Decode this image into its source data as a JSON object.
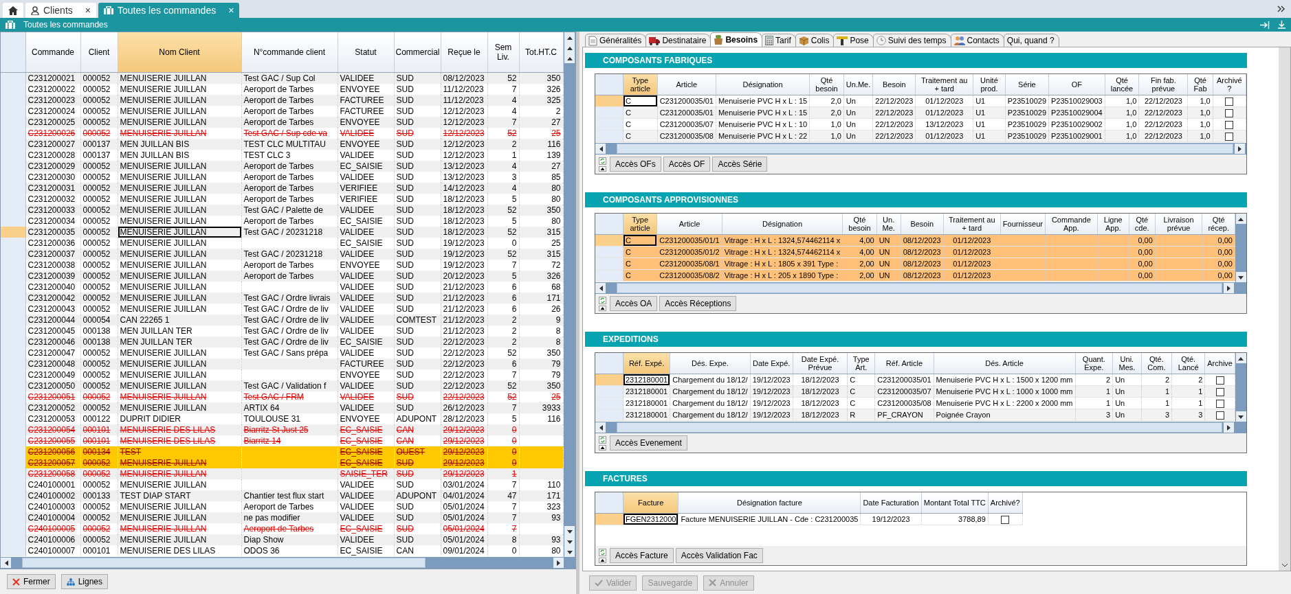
{
  "app_tabs": [
    {
      "label": "Clients",
      "selected": false,
      "close": "×"
    },
    {
      "label": "Toutes les commandes",
      "selected": true,
      "close": "×"
    }
  ],
  "orders": {
    "title": "Toutes les commandes",
    "columns": [
      {
        "label": "Commande",
        "sorted": false
      },
      {
        "label": "Client",
        "sorted": false
      },
      {
        "label": "Nom Client",
        "sorted": true
      },
      {
        "label": "N°commande client",
        "sorted": false
      },
      {
        "label": "Statut",
        "sorted": false
      },
      {
        "label": "Commercial",
        "sorted": false
      },
      {
        "label": "Reçue le",
        "sorted": false
      },
      {
        "label": "Sem Liv.",
        "sorted": false
      },
      {
        "label": "Tot.HT.C",
        "sorted": false
      }
    ],
    "rows": [
      {
        "selected": false,
        "deleted": false,
        "highlighted": false,
        "cells": [
          "C231200021",
          "000052",
          "MENUISERIE JUILLAN",
          "Test GAC / Sup Col",
          "VALIDEE",
          "SUD",
          "08/12/2023",
          "52",
          "350"
        ]
      },
      {
        "selected": false,
        "deleted": false,
        "highlighted": false,
        "cells": [
          "C231200022",
          "000052",
          "MENUISERIE JUILLAN",
          "Aeroport de Tarbes",
          "ENVOYEE",
          "SUD",
          "11/12/2023",
          "7",
          "326"
        ]
      },
      {
        "selected": false,
        "deleted": false,
        "highlighted": false,
        "cells": [
          "C231200023",
          "000052",
          "MENUISERIE JUILLAN",
          "Aeroport de Tarbes",
          "FACTUREE",
          "SUD",
          "11/12/2023",
          "4",
          "325"
        ]
      },
      {
        "selected": false,
        "deleted": false,
        "highlighted": false,
        "cells": [
          "C231200024",
          "000052",
          "MENUISERIE JUILLAN",
          "Aeroport de Tarbes",
          "FACTUREE",
          "SUD",
          "12/12/2023",
          "4",
          "2"
        ]
      },
      {
        "selected": false,
        "deleted": false,
        "highlighted": false,
        "cells": [
          "C231200025",
          "000052",
          "MENUISERIE JUILLAN",
          "Aeroport de Tarbes",
          "ENVOYEE",
          "SUD",
          "12/12/2023",
          "7",
          "27"
        ]
      },
      {
        "selected": false,
        "deleted": true,
        "highlighted": false,
        "cells": [
          "C231200026",
          "000052",
          "MENUISERIE JUILLAN",
          "Test GAC / Sup cde va",
          "VALIDEE",
          "SUD",
          "12/12/2023",
          "52",
          "25"
        ]
      },
      {
        "selected": false,
        "deleted": false,
        "highlighted": false,
        "cells": [
          "C231200027",
          "000137",
          "MEN JUILLAN BIS",
          "TEST CLC MULTITAU",
          "ENVOYEE",
          "SUD",
          "12/12/2023",
          "2",
          "116"
        ]
      },
      {
        "selected": false,
        "deleted": false,
        "highlighted": false,
        "cells": [
          "C231200028",
          "000137",
          "MEN JUILLAN BIS",
          "TEST CLC 3",
          "VALIDEE",
          "SUD",
          "12/12/2023",
          "1",
          "139"
        ]
      },
      {
        "selected": false,
        "deleted": false,
        "highlighted": false,
        "cells": [
          "C231200029",
          "000052",
          "MENUISERIE JUILLAN",
          "Aeroport de Tarbes",
          "EC_SAISIE",
          "SUD",
          "13/12/2023",
          "4",
          "27"
        ]
      },
      {
        "selected": false,
        "deleted": false,
        "highlighted": false,
        "cells": [
          "C231200030",
          "000052",
          "MENUISERIE JUILLAN",
          "Aeroport de Tarbes",
          "VALIDEE",
          "SUD",
          "13/12/2023",
          "3",
          "85"
        ]
      },
      {
        "selected": false,
        "deleted": false,
        "highlighted": false,
        "cells": [
          "C231200031",
          "000052",
          "MENUISERIE JUILLAN",
          "Aeroport de Tarbes",
          "VERIFIEE",
          "SUD",
          "14/12/2023",
          "4",
          "80"
        ]
      },
      {
        "selected": false,
        "deleted": false,
        "highlighted": false,
        "cells": [
          "C231200032",
          "000052",
          "MENUISERIE JUILLAN",
          "Aeroport de Tarbes",
          "VERIFIEE",
          "SUD",
          "18/12/2023",
          "5",
          "80"
        ]
      },
      {
        "selected": false,
        "deleted": false,
        "highlighted": false,
        "cells": [
          "C231200033",
          "000052",
          "MENUISERIE JUILLAN",
          "Test GAC / Palette de",
          "VALIDEE",
          "SUD",
          "18/12/2023",
          "52",
          "350"
        ]
      },
      {
        "selected": false,
        "deleted": false,
        "highlighted": false,
        "cells": [
          "C231200034",
          "000052",
          "MENUISERIE JUILLAN",
          "Aeroport de Tarbes",
          "EC_SAISIE",
          "SUD",
          "18/12/2023",
          "5",
          "80"
        ]
      },
      {
        "selected": true,
        "deleted": false,
        "highlighted": false,
        "cells": [
          "C231200035",
          "000052",
          "MENUISERIE JUILLAN",
          "Test GAC / 20231218",
          "VALIDEE",
          "SUD",
          "18/12/2023",
          "52",
          "315"
        ]
      },
      {
        "selected": false,
        "deleted": false,
        "highlighted": false,
        "cells": [
          "C231200036",
          "000052",
          "MENUISERIE JUILLAN",
          null,
          "EC_SAISIE",
          "SUD",
          "19/12/2023",
          "0",
          "25"
        ]
      },
      {
        "selected": false,
        "deleted": false,
        "highlighted": false,
        "cells": [
          "C231200037",
          "000052",
          "MENUISERIE JUILLAN",
          "Test GAC / 20231218",
          "VALIDEE",
          "SUD",
          "19/12/2023",
          "52",
          "315"
        ]
      },
      {
        "selected": false,
        "deleted": false,
        "highlighted": false,
        "cells": [
          "C231200038",
          "000052",
          "MENUISERIE JUILLAN",
          "Aeroport de Tarbes",
          "ENVOYEE",
          "SUD",
          "19/12/2023",
          "7",
          "72"
        ]
      },
      {
        "selected": false,
        "deleted": false,
        "highlighted": false,
        "cells": [
          "C231200039",
          "000052",
          "MENUISERIE JUILLAN",
          "Aeroport de Tarbes",
          "VALIDEE",
          "SUD",
          "20/12/2023",
          "5",
          "326"
        ]
      },
      {
        "selected": false,
        "deleted": false,
        "highlighted": false,
        "cells": [
          "C231200040",
          "000052",
          "MENUISERIE JUILLAN",
          null,
          "VALIDEE",
          "SUD",
          "21/12/2023",
          "6",
          "68"
        ]
      },
      {
        "selected": false,
        "deleted": false,
        "highlighted": false,
        "cells": [
          "C231200042",
          "000052",
          "MENUISERIE JUILLAN",
          "Test GAC / Ordre livrais",
          "VALIDEE",
          "SUD",
          "21/12/2023",
          "6",
          "171"
        ]
      },
      {
        "selected": false,
        "deleted": false,
        "highlighted": false,
        "cells": [
          "C231200043",
          "000052",
          "MENUISERIE JUILLAN",
          "Test GAC / Ordre de liv",
          "VALIDEE",
          "SUD",
          "21/12/2023",
          "6",
          "26"
        ]
      },
      {
        "selected": false,
        "deleted": false,
        "highlighted": false,
        "cells": [
          "C231200044",
          "000054",
          "CAN 22265 1",
          "Test GAC / Ordre de liv",
          "VALIDEE",
          "COMTEST",
          "21/12/2023",
          "2",
          "9"
        ]
      },
      {
        "selected": false,
        "deleted": false,
        "highlighted": false,
        "cells": [
          "C231200045",
          "000138",
          "MEN JUILLAN TER",
          "Test GAC / Ordre de liv",
          "VALIDEE",
          "SUD",
          "21/12/2023",
          "2",
          "8"
        ]
      },
      {
        "selected": false,
        "deleted": false,
        "highlighted": false,
        "cells": [
          "C231200046",
          "000138",
          "MEN JUILLAN TER",
          "Test GAC / Ordre de liv",
          "EC_SAISIE",
          "SUD",
          "22/12/2023",
          "2",
          "8"
        ]
      },
      {
        "selected": false,
        "deleted": false,
        "highlighted": false,
        "cells": [
          "C231200047",
          "000052",
          "MENUISERIE JUILLAN",
          "Test GAC / Sans prépa",
          "VALIDEE",
          "SUD",
          "22/12/2023",
          "52",
          "350"
        ]
      },
      {
        "selected": false,
        "deleted": false,
        "highlighted": false,
        "cells": [
          "C231200048",
          "000052",
          "MENUISERIE JUILLAN",
          null,
          "FACTUREE",
          "SUD",
          "22/12/2023",
          "6",
          "79"
        ]
      },
      {
        "selected": false,
        "deleted": false,
        "highlighted": false,
        "cells": [
          "C231200049",
          "000052",
          "MENUISERIE JUILLAN",
          null,
          "ENVOYEE",
          "SUD",
          "22/12/2023",
          "7",
          "79"
        ]
      },
      {
        "selected": false,
        "deleted": false,
        "highlighted": false,
        "cells": [
          "C231200050",
          "000052",
          "MENUISERIE JUILLAN",
          "Test GAC / Validation f",
          "VALIDEE",
          "SUD",
          "22/12/2023",
          "52",
          "350"
        ]
      },
      {
        "selected": false,
        "deleted": true,
        "highlighted": false,
        "cells": [
          "C231200051",
          "000052",
          "MENUISERIE JUILLAN",
          "Test GAC / FRM",
          "VALIDEE",
          "SUD",
          "22/12/2023",
          "52",
          "25"
        ]
      },
      {
        "selected": false,
        "deleted": false,
        "highlighted": false,
        "cells": [
          "C231200052",
          "000052",
          "MENUISERIE JUILLAN",
          "ARTIX 64",
          "VALIDEE",
          "SUD",
          "26/12/2023",
          "7",
          "3933"
        ]
      },
      {
        "selected": false,
        "deleted": false,
        "highlighted": false,
        "cells": [
          "C231200053",
          "000122",
          "DUPRIT DIDIER",
          "TOULOUSE 31",
          "ENVOYEE",
          "ADUPONT",
          "28/12/2023",
          "5",
          "116"
        ]
      },
      {
        "selected": false,
        "deleted": true,
        "highlighted": false,
        "cells": [
          "C231200054",
          "000101",
          "MENUISERIE DES LILAS",
          "Biarritz St Just 25",
          "EC_SAISIE",
          "CAN",
          "29/12/2023",
          "0",
          null
        ]
      },
      {
        "selected": false,
        "deleted": true,
        "highlighted": false,
        "cells": [
          "C231200055",
          "000101",
          "MENUISERIE DES LILAS",
          "Biarritz 14",
          "EC_SAISIE",
          "CAN",
          "29/12/2023",
          "0",
          null
        ]
      },
      {
        "selected": false,
        "deleted": true,
        "highlighted": true,
        "cells": [
          "C231200056",
          "000134",
          "TEST",
          null,
          "EC_SAISIE",
          "OUEST",
          "29/12/2023",
          "0",
          null
        ]
      },
      {
        "selected": false,
        "deleted": true,
        "highlighted": true,
        "cells": [
          "C231200057",
          "000052",
          "MENUISERIE JUILLAN",
          null,
          "EC_SAISIE",
          "SUD",
          "29/12/2023",
          "0",
          null
        ]
      },
      {
        "selected": false,
        "deleted": true,
        "highlighted": false,
        "cells": [
          "C231200058",
          "000052",
          "MENUISERIE JUILLAN",
          null,
          "SAISIE_TER",
          "SUD",
          "29/12/2023",
          "1",
          null
        ]
      },
      {
        "selected": false,
        "deleted": false,
        "highlighted": false,
        "cells": [
          "C240100001",
          "000052",
          "MENUISERIE JUILLAN",
          null,
          "VALIDEE",
          "SUD",
          "03/01/2024",
          "7",
          "110"
        ]
      },
      {
        "selected": false,
        "deleted": false,
        "highlighted": false,
        "cells": [
          "C240100002",
          "000133",
          "TEST DIAP START",
          "Chantier test flux start",
          "VALIDEE",
          "ADUPONT",
          "04/01/2024",
          "47",
          "171"
        ]
      },
      {
        "selected": false,
        "deleted": false,
        "highlighted": false,
        "cells": [
          "C240100003",
          "000052",
          "MENUISERIE JUILLAN",
          "Aeroport de Tarbes",
          "VALIDEE",
          "SUD",
          "05/01/2024",
          "7",
          "323"
        ]
      },
      {
        "selected": false,
        "deleted": false,
        "highlighted": false,
        "cells": [
          "C240100004",
          "000052",
          "MENUISERIE JUILLAN",
          "ne pas modifier",
          "VALIDEE",
          "SUD",
          "05/01/2024",
          "7",
          "93"
        ]
      },
      {
        "selected": false,
        "deleted": true,
        "highlighted": false,
        "cells": [
          "C240100005",
          "000052",
          "MENUISERIE JUILLAN",
          "Aeroport de Tarbes",
          "EC_SAISIE",
          "SUD",
          "05/01/2024",
          "7",
          null
        ]
      },
      {
        "selected": false,
        "deleted": false,
        "highlighted": false,
        "cells": [
          "C240100006",
          "000052",
          "MENUISERIE JUILLAN",
          "Diap Show",
          "VALIDEE",
          "SUD",
          "05/01/2024",
          "8",
          "93"
        ]
      },
      {
        "selected": false,
        "deleted": false,
        "highlighted": false,
        "cells": [
          "C240100007",
          "000101",
          "MENUISERIE DES LILAS",
          "ODOS 36",
          "EC_SAISIE",
          "CAN",
          "09/01/2024",
          "0",
          "80"
        ]
      }
    ],
    "buttons": [
      {
        "label": "Fermer"
      },
      {
        "label": "Lignes"
      }
    ]
  },
  "detail": {
    "tabs": [
      {
        "label": "Généralités",
        "selected": false
      },
      {
        "label": "Destinataire",
        "selected": false
      },
      {
        "label": "Besoins",
        "selected": true
      },
      {
        "label": "Tarif",
        "selected": false
      },
      {
        "label": "Colis",
        "selected": false
      },
      {
        "label": "Pose",
        "selected": false
      },
      {
        "label": "Suivi des temps",
        "selected": false
      },
      {
        "label": "Contacts",
        "selected": false
      },
      {
        "label": "Qui, quand ?",
        "selected": false
      }
    ],
    "sections": [
      {
        "title": "COMPOSANTS FABRIQUES",
        "columns": [
          {
            "label": "Type article",
            "sorted": true
          },
          {
            "label": "Article",
            "sorted": false
          },
          {
            "label": "Désignation",
            "sorted": false
          },
          {
            "label": "Qté besoin",
            "sorted": false
          },
          {
            "label": "Un.Me.",
            "sorted": false
          },
          {
            "label": "Besoin",
            "sorted": false
          },
          {
            "label": "Traitement au + tard",
            "sorted": false
          },
          {
            "label": "Unité prod.",
            "sorted": false
          },
          {
            "label": "Série",
            "sorted": false
          },
          {
            "label": "OF",
            "sorted": false
          },
          {
            "label": "Qté lancée",
            "sorted": false
          },
          {
            "label": "Fin fab. prévue",
            "sorted": false
          },
          {
            "label": "Qté Fab",
            "sorted": false
          },
          {
            "label": "Archivé ?",
            "sorted": false
          }
        ],
        "rows": [
          {
            "selected": true,
            "archived": false,
            "cells": [
              "C",
              "C231200035/01",
              "Menuiserie PVC H x L : 15",
              "2,0",
              "Un",
              "22/12/2023",
              "01/12/2023",
              "U1",
              "P23510029",
              "P23510029003",
              "1,0",
              "22/12/2023",
              "1,0"
            ]
          },
          {
            "selected": false,
            "archived": false,
            "cells": [
              "C",
              "C231200035/01",
              "Menuiserie PVC H x L : 15",
              "2,0",
              "Un",
              "22/12/2023",
              "01/12/2023",
              "U1",
              "P23510029",
              "P23510029004",
              "1,0",
              "22/12/2023",
              "1,0"
            ]
          },
          {
            "selected": false,
            "archived": false,
            "cells": [
              "C",
              "C231200035/07",
              "Menuiserie PVC H x L : 10",
              "1,0",
              "Un",
              "22/12/2023",
              "13/12/2023",
              "U1",
              "P23510029",
              "P23510029002",
              "1,0",
              "22/12/2023",
              "1,0"
            ]
          },
          {
            "selected": false,
            "archived": false,
            "cells": [
              "C",
              "C231200035/08",
              "Menuiserie PVC H x L : 22",
              "1,0",
              "Un",
              "22/12/2023",
              "01/12/2023",
              "U1",
              "P23510029",
              "P23510029001",
              "1,0",
              "22/12/2023",
              "1,0"
            ]
          }
        ],
        "buttons": [
          {
            "label": "Accès OFs"
          },
          {
            "label": "Accès OF"
          },
          {
            "label": "Accès Série"
          }
        ]
      },
      {
        "title": "COMPOSANTS APPROVISIONNES",
        "columns": [
          {
            "label": "Type article",
            "sorted": true
          },
          {
            "label": "Article",
            "sorted": false
          },
          {
            "label": "Désignation",
            "sorted": false
          },
          {
            "label": "Qté besoin",
            "sorted": false
          },
          {
            "label": "Un. Me.",
            "sorted": false
          },
          {
            "label": "Besoin",
            "sorted": false
          },
          {
            "label": "Traitement au + tard",
            "sorted": false
          },
          {
            "label": "Fournisseur",
            "sorted": false
          },
          {
            "label": "Commande App.",
            "sorted": false
          },
          {
            "label": "Ligne App.",
            "sorted": false
          },
          {
            "label": "Qté cde.",
            "sorted": false
          },
          {
            "label": "Livraison prévue",
            "sorted": false
          },
          {
            "label": "Qté récep.",
            "sorted": false
          }
        ],
        "rows": [
          {
            "selected": true,
            "highlighted": true,
            "cells": [
              "C",
              "C231200035/01/1",
              "Vitrage : H x L : 1324,574462114 x",
              "4,00",
              "UN",
              "08/12/2023",
              "01/12/2023",
              null,
              null,
              null,
              "0,00",
              null,
              "0,00"
            ]
          },
          {
            "selected": false,
            "highlighted": true,
            "cells": [
              "C",
              "C231200035/01/2",
              "Vitrage : H x L : 1324,574462114 x",
              "4,00",
              "UN",
              "08/12/2023",
              "01/12/2023",
              null,
              null,
              null,
              "0,00",
              null,
              "0,00"
            ]
          },
          {
            "selected": false,
            "highlighted": true,
            "cells": [
              "C",
              "C231200035/08/1",
              "Vitrage : H x L : 1805 x 391 Type :",
              "2,00",
              "UN",
              "08/12/2023",
              "01/12/2023",
              null,
              null,
              null,
              "0,00",
              null,
              "0,00"
            ]
          },
          {
            "selected": false,
            "highlighted": true,
            "cells": [
              "C",
              "C231200035/08/2",
              "Vitrage : H x L : 205 x 1890 Type :",
              "2,00",
              "UN",
              "08/12/2023",
              "01/12/2023",
              null,
              null,
              null,
              "0,00",
              null,
              "0,00"
            ]
          }
        ],
        "buttons": [
          {
            "label": "Accès OA"
          },
          {
            "label": "Accès Réceptions"
          }
        ]
      },
      {
        "title": "EXPEDITIONS",
        "columns": [
          {
            "label": "Réf. Expé.",
            "sorted": true
          },
          {
            "label": "Dés. Expe.",
            "sorted": false
          },
          {
            "label": "Date Expé.",
            "sorted": false
          },
          {
            "label": "Date Expé. Prévue",
            "sorted": false
          },
          {
            "label": "Type Art.",
            "sorted": false
          },
          {
            "label": "Réf. Article",
            "sorted": false
          },
          {
            "label": "Dés. Article",
            "sorted": false
          },
          {
            "label": "Quant. Expe.",
            "sorted": false
          },
          {
            "label": "Uni. Mes.",
            "sorted": false
          },
          {
            "label": "Qté. Com.",
            "sorted": false
          },
          {
            "label": "Qté. Lancé",
            "sorted": false
          },
          {
            "label": "Archive",
            "sorted": false
          }
        ],
        "rows": [
          {
            "selected": true,
            "archived": false,
            "cells": [
              "2312180001",
              "Chargement du 18/12/",
              "19/12/2023",
              "18/12/2023",
              "C",
              "C231200035/01",
              "Menuiserie PVC H x L : 1500 x 1200 mm",
              "2",
              "Un",
              "2",
              "2"
            ]
          },
          {
            "selected": false,
            "archived": false,
            "cells": [
              "2312180001",
              "Chargement du 18/12/",
              "19/12/2023",
              "18/12/2023",
              "C",
              "C231200035/07",
              "Menuiserie PVC H x L : 1000 x 1000 mm",
              "1",
              "Un",
              "1",
              "1"
            ]
          },
          {
            "selected": false,
            "archived": false,
            "cells": [
              "2312180001",
              "Chargement du 18/12/",
              "19/12/2023",
              "18/12/2023",
              "C",
              "C231200035/08",
              "Menuiserie PVC H x L : 2200 x 2000 mm",
              "1",
              "Un",
              "1",
              "1"
            ]
          },
          {
            "selected": false,
            "archived": false,
            "cells": [
              "2312180001",
              "Chargement du 18/12/",
              "19/12/2023",
              "18/12/2023",
              "R",
              "PF_CRAYON",
              "Poignée Crayon",
              "3",
              "Un",
              "3",
              "3"
            ]
          }
        ],
        "buttons": [
          {
            "label": "Accès Evenement"
          }
        ]
      },
      {
        "title": "FACTURES",
        "columns": [
          {
            "label": "Facture",
            "sorted": true
          },
          {
            "label": "Désignation facture",
            "sorted": false
          },
          {
            "label": "Date Facturation",
            "sorted": false
          },
          {
            "label": "Montant Total TTC",
            "sorted": false
          },
          {
            "label": "Archivé?",
            "sorted": false
          }
        ],
        "rows": [
          {
            "selected": true,
            "archived": false,
            "cells": [
              "FGEN2312000",
              "Facture MENUISERIE JUILLAN - Cde : C231200035",
              "19/12/2023",
              "3788,89"
            ]
          }
        ],
        "buttons": [
          {
            "label": "Accès Facture"
          },
          {
            "label": "Accès Validation Fac"
          }
        ]
      }
    ],
    "buttons": [
      {
        "label": "Valider",
        "disabled": true
      },
      {
        "label": "Sauvegarde",
        "disabled": true
      },
      {
        "label": "Annuler",
        "disabled": true
      }
    ]
  }
}
